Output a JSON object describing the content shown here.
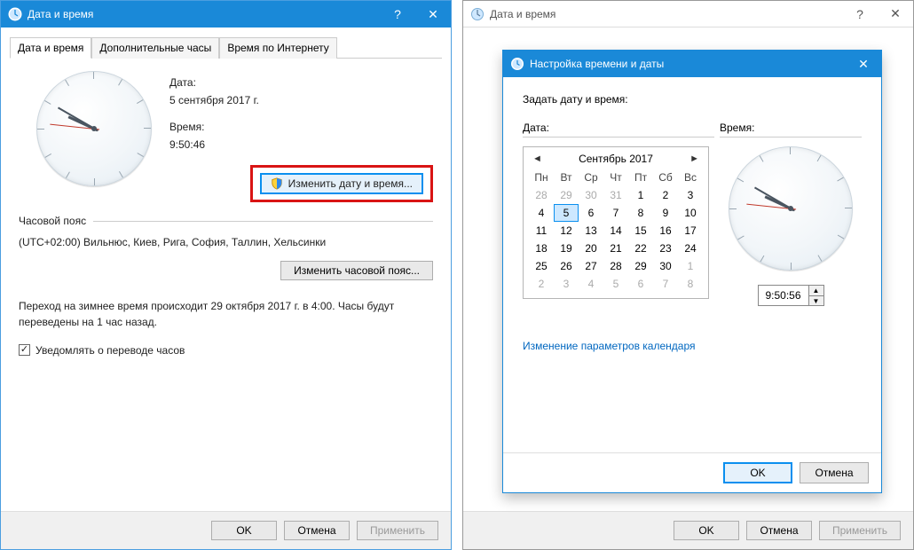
{
  "win1": {
    "title": "Дата и время",
    "tabs": [
      "Дата и время",
      "Дополнительные часы",
      "Время по Интернету"
    ],
    "date_label": "Дата:",
    "date_value": "5 сентября 2017 г.",
    "time_label": "Время:",
    "time_value": "9:50:46",
    "change_dt_btn": "Изменить дату и время...",
    "tz_section": "Часовой пояс",
    "tz_value": "(UTC+02:00) Вильнюс, Киев, Рига, София, Таллин, Хельсинки",
    "change_tz_btn": "Изменить часовой пояс...",
    "dst_text": "Переход на зимнее время происходит 29 октября 2017 г. в 4:00. Часы будут переведены на 1 час назад.",
    "notify_label": "Уведомлять о переводе часов",
    "ok": "OK",
    "cancel": "Отмена",
    "apply": "Применить"
  },
  "win2": {
    "title": "Дата и время",
    "ok": "OK",
    "cancel": "Отмена",
    "apply": "Применить"
  },
  "modal": {
    "title": "Настройка времени и даты",
    "heading": "Задать дату и время:",
    "date_label": "Дата:",
    "time_label": "Время:",
    "cal_title": "Сентябрь 2017",
    "dow": [
      "Пн",
      "Вт",
      "Ср",
      "Чт",
      "Пт",
      "Сб",
      "Вс"
    ],
    "weeks": [
      [
        {
          "d": 28,
          "o": true
        },
        {
          "d": 29,
          "o": true
        },
        {
          "d": 30,
          "o": true
        },
        {
          "d": 31,
          "o": true
        },
        {
          "d": 1
        },
        {
          "d": 2
        },
        {
          "d": 3
        }
      ],
      [
        {
          "d": 4
        },
        {
          "d": 5,
          "sel": true
        },
        {
          "d": 6
        },
        {
          "d": 7
        },
        {
          "d": 8
        },
        {
          "d": 9
        },
        {
          "d": 10
        }
      ],
      [
        {
          "d": 11
        },
        {
          "d": 12
        },
        {
          "d": 13
        },
        {
          "d": 14
        },
        {
          "d": 15
        },
        {
          "d": 16
        },
        {
          "d": 17
        }
      ],
      [
        {
          "d": 18
        },
        {
          "d": 19
        },
        {
          "d": 20
        },
        {
          "d": 21
        },
        {
          "d": 22
        },
        {
          "d": 23
        },
        {
          "d": 24
        }
      ],
      [
        {
          "d": 25
        },
        {
          "d": 26
        },
        {
          "d": 27
        },
        {
          "d": 28
        },
        {
          "d": 29
        },
        {
          "d": 30
        },
        {
          "d": 1,
          "o": true
        }
      ],
      [
        {
          "d": 2,
          "o": true
        },
        {
          "d": 3,
          "o": true
        },
        {
          "d": 4,
          "o": true
        },
        {
          "d": 5,
          "o": true
        },
        {
          "d": 6,
          "o": true
        },
        {
          "d": 7,
          "o": true
        },
        {
          "d": 8,
          "o": true
        }
      ]
    ],
    "time_value": "9:50:56",
    "calendar_link": "Изменение параметров календаря",
    "ok": "OK",
    "cancel": "Отмена"
  },
  "clock": {
    "hour_angle": 295,
    "min_angle": 300,
    "sec_angle": 276
  }
}
